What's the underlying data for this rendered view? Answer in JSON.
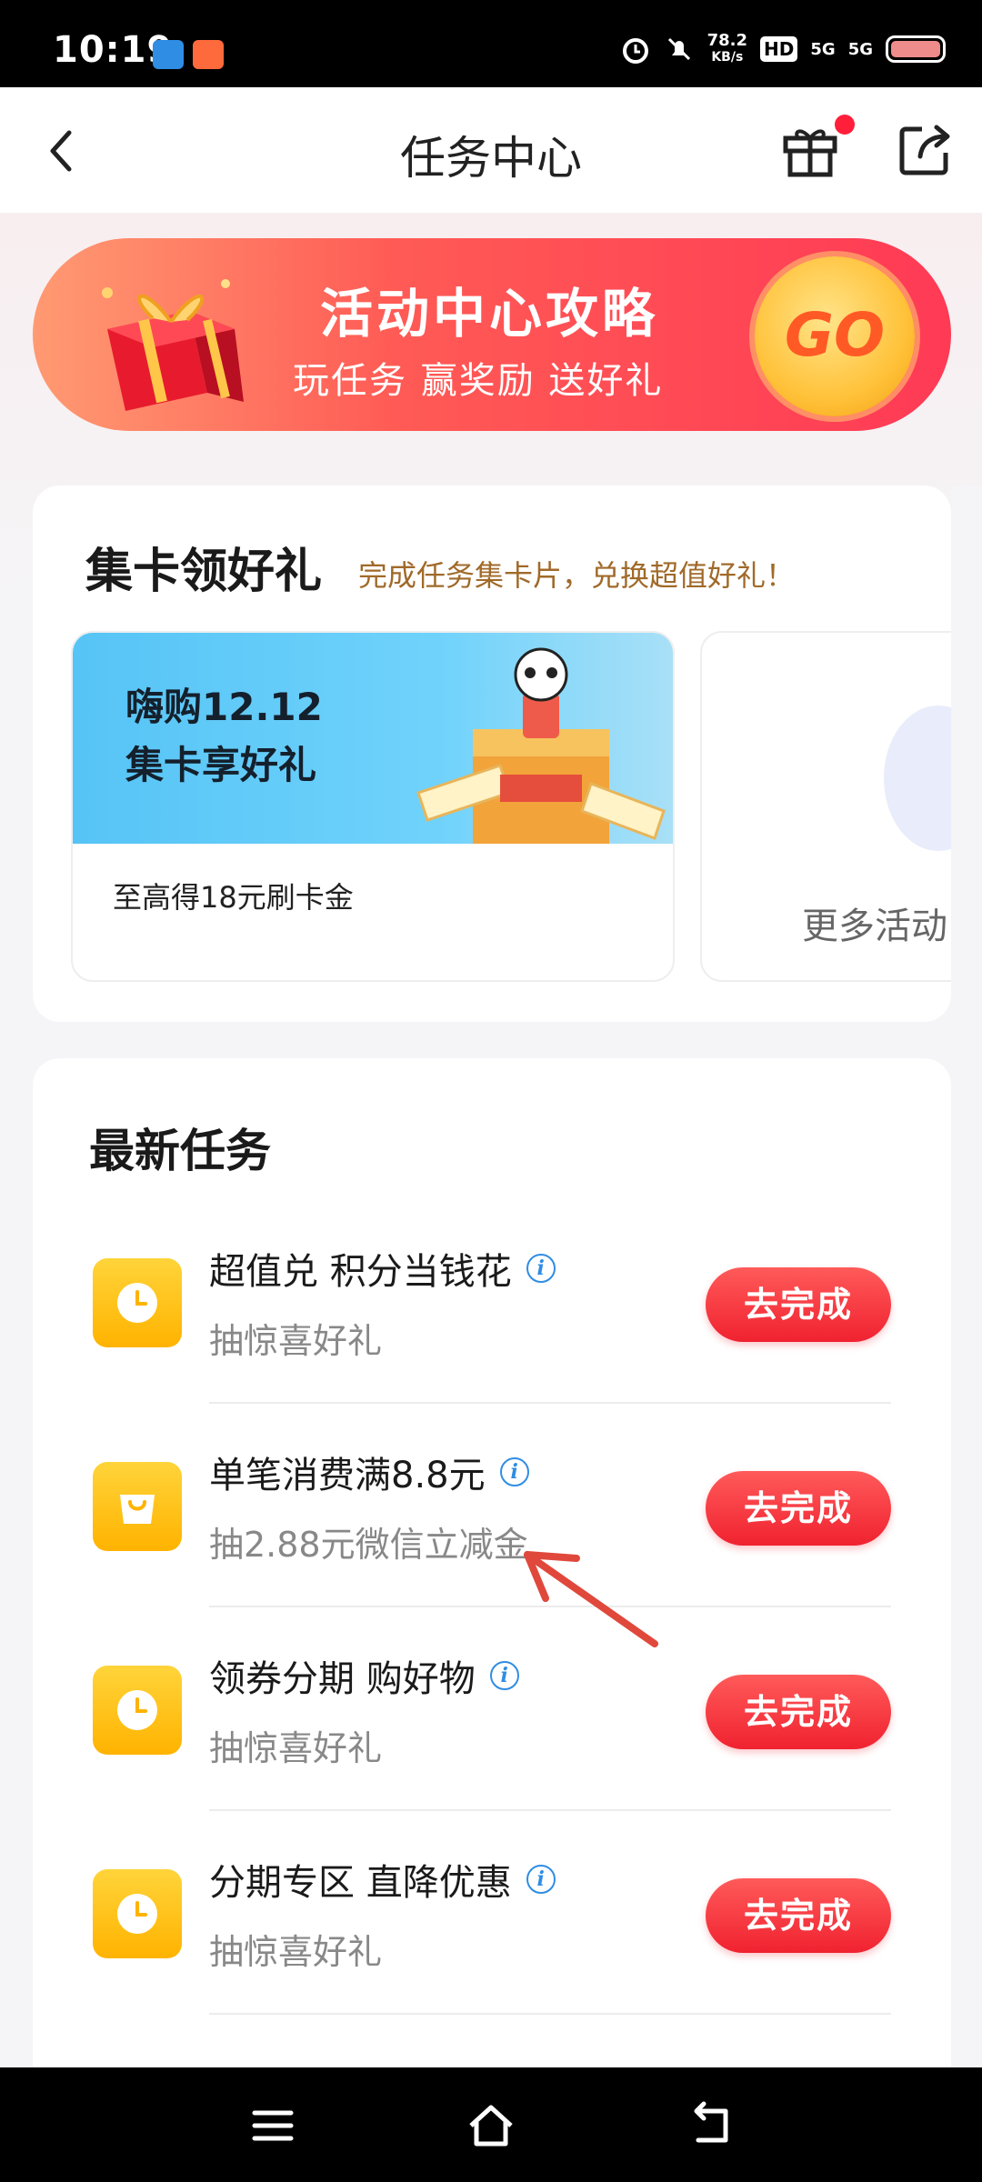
{
  "status_bar": {
    "time": "10:19",
    "speed_value": "78.2",
    "speed_unit": "KB/s",
    "hd": "HD",
    "signal1": "5G",
    "signal2": "5G"
  },
  "header": {
    "title": "任务中心"
  },
  "banner": {
    "title": "活动中心攻略",
    "subtitle": "玩任务 赢奖励 送好礼",
    "go_label": "GO"
  },
  "collect_cards": {
    "heading": "集卡领好礼",
    "subheading": "完成任务集卡片，兑换超值好礼！",
    "promo": {
      "line1": "嗨购12.12",
      "line2": "集卡享好礼",
      "desc": "至高得18元刷卡金"
    },
    "more_label": "更多活动"
  },
  "tasks": {
    "heading": "最新任务",
    "items": [
      {
        "title": "超值兑 积分当钱花",
        "subtitle": "抽惊喜好礼",
        "button": "去完成",
        "icon": "clock-icon"
      },
      {
        "title": "单笔消费满8.8元",
        "subtitle": "抽2.88元微信立减金",
        "button": "去完成",
        "icon": "shopping-bag-icon"
      },
      {
        "title": "领券分期 购好物",
        "subtitle": "抽惊喜好礼",
        "button": "去完成",
        "icon": "clock-icon"
      },
      {
        "title": "分期专区 直降优惠",
        "subtitle": "抽惊喜好礼",
        "button": "去完成",
        "icon": "clock-icon"
      }
    ]
  },
  "colors": {
    "accent_red": "#f02230",
    "icon_yellow": "#ffc21a",
    "info_blue": "#2f8de4"
  }
}
